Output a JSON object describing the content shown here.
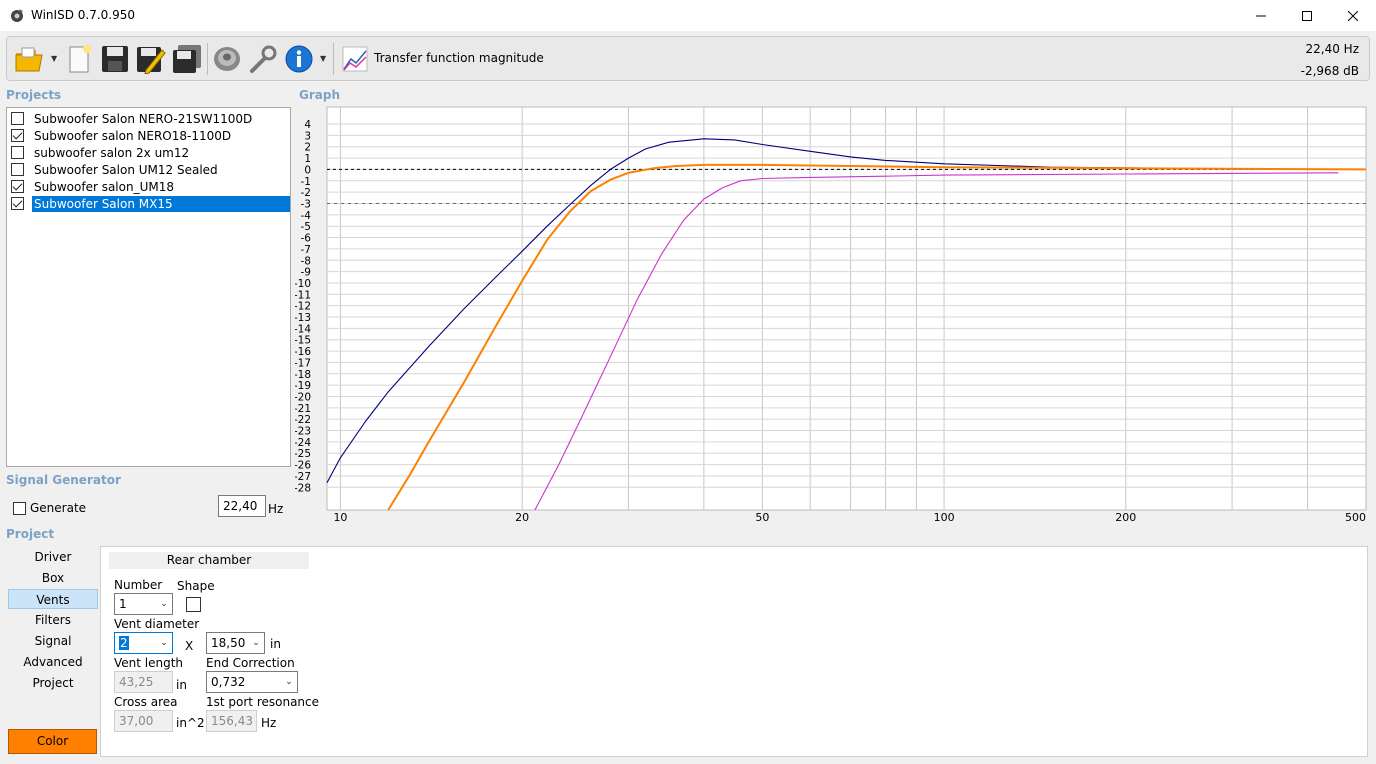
{
  "window": {
    "title": "WinISD 0.7.0.950",
    "minimize": "—",
    "maximize": "☐",
    "close": "✕"
  },
  "toolbar": {
    "buttons": [
      "open-icon",
      "new-icon",
      "save-icon",
      "edit-icon",
      "save-all-icon",
      "driver-icon",
      "tools-icon",
      "info-icon",
      "graph-icon"
    ],
    "graph_title": "Transfer function magnitude",
    "readout_freq": "22,40 Hz",
    "readout_level": "-2,968 dB"
  },
  "projects": {
    "heading": "Projects",
    "items": [
      {
        "label": "Subwoofer Salon NERO-21SW1100D",
        "checked": false,
        "selected": false
      },
      {
        "label": "Subwoofer salon NERO18-1100D",
        "checked": true,
        "selected": false
      },
      {
        "label": "subwoofer salon 2x um12",
        "checked": false,
        "selected": false
      },
      {
        "label": "Subwoofer Salon UM12 Sealed",
        "checked": false,
        "selected": false
      },
      {
        "label": "Subwoofer salon_UM18",
        "checked": true,
        "selected": false
      },
      {
        "label": "Subwoofer Salon MX15",
        "checked": true,
        "selected": true
      }
    ]
  },
  "signal_generator": {
    "heading": "Signal Generator",
    "generate_label": "Generate",
    "generate_checked": false,
    "frequency": "22,40",
    "unit": "Hz"
  },
  "project_section": {
    "heading": "Project",
    "nav": [
      "Driver",
      "Box",
      "Vents",
      "Filters",
      "Signal",
      "Advanced",
      "Project"
    ],
    "active_nav": "Vents",
    "color_button": "Color",
    "color": "#ff8000"
  },
  "vents": {
    "tab": "Rear chamber",
    "number_label": "Number",
    "number_value": "1",
    "shape_label": "Shape",
    "vent_diameter_label": "Vent diameter",
    "vent_diameter_value": "2",
    "x_label": "X",
    "vent_size_value": "18,50",
    "vent_size_unit": "in",
    "vent_length_label": "Vent length",
    "vent_length_value": "43,25",
    "vent_length_unit": "in",
    "end_correction_label": "End Correction",
    "end_correction_value": "0,732",
    "cross_area_label": "Cross area",
    "cross_area_value": "37,00",
    "cross_area_unit": "in^2",
    "port_resonance_label": "1st port resonance",
    "port_resonance_value": "156,43",
    "port_resonance_unit": "Hz"
  },
  "graph": {
    "heading": "Graph",
    "x_ticks": [
      "10",
      "20",
      "50",
      "100",
      "200",
      "500"
    ],
    "y_ticks": [
      "4",
      "3",
      "2",
      "1",
      "0",
      "-1",
      "-2",
      "-3",
      "-4",
      "-5",
      "-6",
      "-7",
      "-8",
      "-9",
      "-10",
      "-11",
      "-12",
      "-13",
      "-14",
      "-15",
      "-16",
      "-17",
      "-18",
      "-19",
      "-20",
      "-21",
      "-22",
      "-23",
      "-24",
      "-25",
      "-26",
      "-27",
      "-28"
    ]
  },
  "chart_data": {
    "type": "line",
    "x_scale": "log",
    "xlim": [
      9.5,
      500
    ],
    "ylim": [
      -30,
      5.5
    ],
    "grid": true,
    "reference_lines": [
      0,
      -3
    ],
    "series": [
      {
        "color": "#000080",
        "x": [
          9.5,
          10,
          11,
          12,
          14,
          16,
          18,
          20,
          22,
          24,
          26,
          28,
          30,
          32,
          35,
          40,
          45,
          50,
          60,
          70,
          80,
          100,
          150,
          235
        ],
        "y": [
          -27.6,
          -25.4,
          -22.2,
          -19.6,
          -15.6,
          -12.3,
          -9.6,
          -7.2,
          -5.0,
          -3.1,
          -1.4,
          0.0,
          1.0,
          1.8,
          2.4,
          2.7,
          2.6,
          2.2,
          1.6,
          1.1,
          0.8,
          0.5,
          0.2,
          0.1
        ]
      },
      {
        "color": "#ff8000",
        "x": [
          12,
          13,
          14,
          16,
          18,
          20,
          22,
          24,
          26,
          28,
          30,
          33,
          36,
          40,
          50,
          70,
          100,
          200,
          500
        ],
        "y": [
          -30.0,
          -27.0,
          -24.0,
          -18.8,
          -14.0,
          -9.8,
          -6.2,
          -3.7,
          -1.9,
          -0.9,
          -0.3,
          0.1,
          0.3,
          0.4,
          0.4,
          0.3,
          0.2,
          0.1,
          0.0
        ]
      },
      {
        "color": "#cc33cc",
        "x": [
          21,
          23,
          25,
          28,
          31,
          34,
          37,
          40,
          43,
          46,
          50,
          60,
          80,
          100,
          200,
          450
        ],
        "y": [
          -30.0,
          -26.0,
          -22.0,
          -16.5,
          -11.5,
          -7.5,
          -4.5,
          -2.6,
          -1.6,
          -1.0,
          -0.8,
          -0.7,
          -0.6,
          -0.5,
          -0.4,
          -0.3
        ]
      }
    ]
  }
}
